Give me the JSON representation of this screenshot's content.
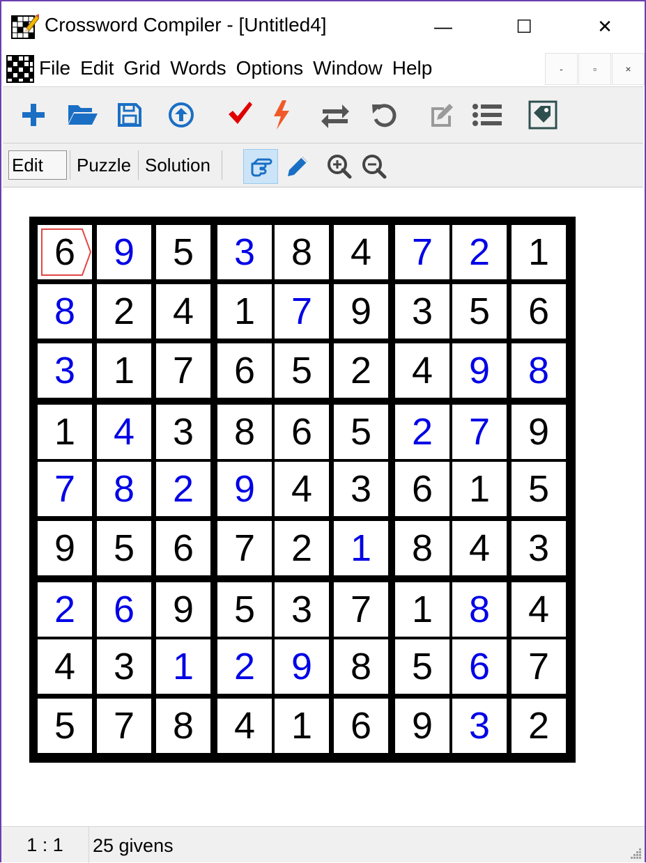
{
  "window": {
    "title": "Crossword Compiler - [Untitled4]",
    "minimize": "—",
    "maximize": "☐",
    "close": "✕"
  },
  "menubar": {
    "items": [
      "File",
      "Edit",
      "Grid",
      "Words",
      "Options",
      "Window",
      "Help"
    ],
    "mdi_minimize": "-",
    "mdi_restore": "▫",
    "mdi_close": "×"
  },
  "toolbar": {
    "icons": [
      "plus-icon",
      "folder-open-icon",
      "save-icon",
      "upload-icon",
      "checkmark-icon",
      "lightning-icon",
      "swap-icon",
      "undo-icon",
      "edit-note-icon",
      "list-icon",
      "tag-icon"
    ]
  },
  "view_tabs": {
    "edit": "Edit",
    "puzzle": "Puzzle",
    "solution": "Solution",
    "active": "Edit"
  },
  "colors": {
    "given": "#000000",
    "solved": "#0000e6",
    "accent_blue": "#1a6fc4",
    "check_red": "#e00000",
    "bolt_orange": "#f05a28",
    "cursor": "#e24545"
  },
  "grid": {
    "rows": [
      [
        "6",
        "9",
        "5",
        "3",
        "8",
        "4",
        "7",
        "2",
        "1"
      ],
      [
        "8",
        "2",
        "4",
        "1",
        "7",
        "9",
        "3",
        "5",
        "6"
      ],
      [
        "3",
        "1",
        "7",
        "6",
        "5",
        "2",
        "4",
        "9",
        "8"
      ],
      [
        "1",
        "4",
        "3",
        "8",
        "6",
        "5",
        "2",
        "7",
        "9"
      ],
      [
        "7",
        "8",
        "2",
        "9",
        "4",
        "3",
        "6",
        "1",
        "5"
      ],
      [
        "9",
        "5",
        "6",
        "7",
        "2",
        "1",
        "8",
        "4",
        "3"
      ],
      [
        "2",
        "6",
        "9",
        "5",
        "3",
        "7",
        "1",
        "8",
        "4"
      ],
      [
        "4",
        "3",
        "1",
        "2",
        "9",
        "8",
        "5",
        "6",
        "7"
      ],
      [
        "5",
        "7",
        "8",
        "4",
        "1",
        "6",
        "9",
        "3",
        "2"
      ]
    ],
    "blue": [
      [
        0,
        1,
        0,
        1,
        0,
        0,
        1,
        1,
        0
      ],
      [
        1,
        0,
        0,
        0,
        1,
        0,
        0,
        0,
        0
      ],
      [
        1,
        0,
        0,
        0,
        0,
        0,
        0,
        1,
        1
      ],
      [
        0,
        1,
        0,
        0,
        0,
        0,
        1,
        1,
        0
      ],
      [
        1,
        1,
        1,
        1,
        0,
        0,
        0,
        0,
        0
      ],
      [
        0,
        0,
        0,
        0,
        0,
        1,
        0,
        0,
        0
      ],
      [
        1,
        1,
        0,
        0,
        0,
        0,
        0,
        1,
        0
      ],
      [
        0,
        0,
        1,
        1,
        1,
        0,
        0,
        1,
        0
      ],
      [
        0,
        0,
        0,
        0,
        0,
        0,
        0,
        1,
        0
      ]
    ],
    "cursor_row": 0,
    "cursor_col": 0
  },
  "status": {
    "position": "1 : 1",
    "text": "25 givens"
  }
}
